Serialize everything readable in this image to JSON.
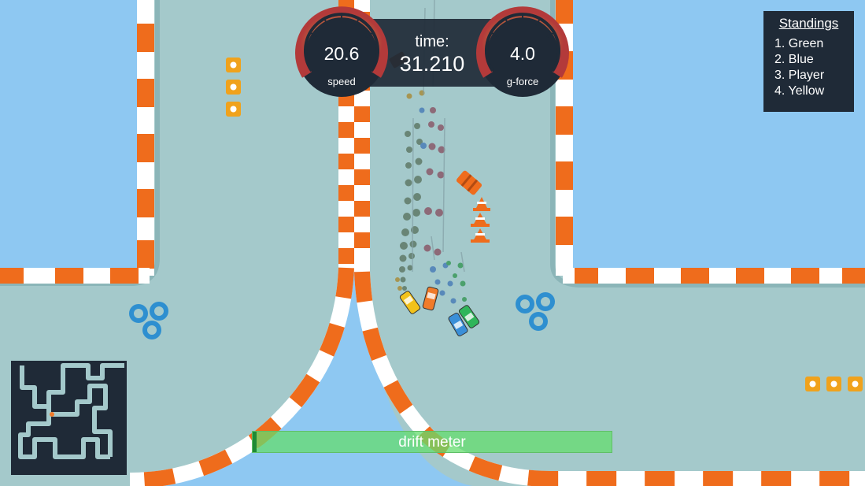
{
  "hud": {
    "time_label": "time:",
    "time_value": "31.210",
    "speed": {
      "value": "20.6",
      "label": "speed"
    },
    "gforce": {
      "value": "4.0",
      "label": "g-force"
    }
  },
  "standings": {
    "title": "Standings",
    "entries": [
      "1. Green",
      "2. Blue",
      "3. Player",
      "4. Yellow"
    ]
  },
  "drift_meter": {
    "label": "drift meter",
    "level": 0.01
  },
  "colors": {
    "track": "#a4c9cb",
    "water": "#8ec8f2",
    "curb_orange": "#ef6c1c",
    "curb_white": "#ffffff",
    "hud_dark": "#1f2a37",
    "car_green": "#2fb55a",
    "car_blue": "#3a8fd8",
    "car_player": "#f07b2a",
    "car_yellow": "#f2c21a"
  },
  "icons": {
    "speed_gauge": "speedometer-icon",
    "gforce_gauge": "gforce-gauge-icon",
    "tire_stack": "tire-stack-icon",
    "traffic_cone": "traffic-cone-icon",
    "barrel": "barrel-icon",
    "minimap": "track-minimap"
  }
}
